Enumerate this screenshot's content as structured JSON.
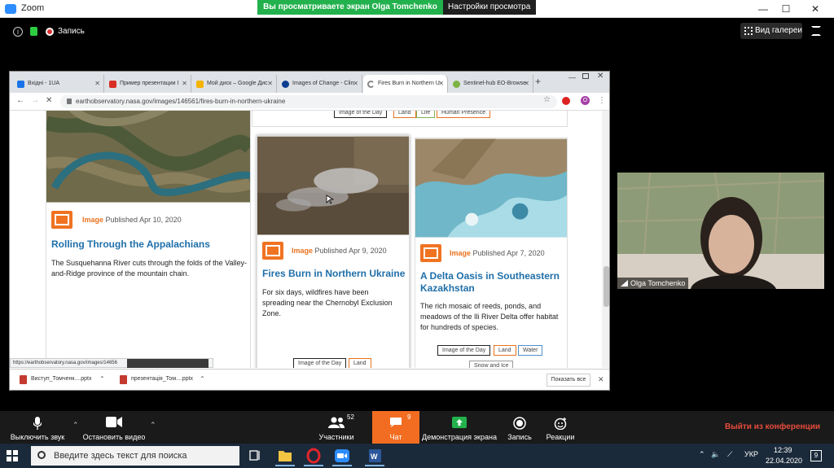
{
  "zoom": {
    "title": "Zoom",
    "share_banner": "Вы просматриваете экран Olga Tomchenko",
    "view_settings": "Настройки просмотра",
    "recording_label": "Запись",
    "gallery_label": "Вид галереи",
    "participant_name": "Olga Tomchenko"
  },
  "browser": {
    "tabs": [
      {
        "label": "Вхідні - 1UA",
        "color": "#1a73e8"
      },
      {
        "label": "Пример презентации І",
        "color": "#d93025"
      },
      {
        "label": "Мой диск – Google Дис",
        "color": "#f4b400"
      },
      {
        "label": "Images of Change - Clin",
        "color": "#0b3d91"
      },
      {
        "label": "Fires Burn in Northern U",
        "color": "#888888"
      },
      {
        "label": "Sentinel-hub EO-Browse",
        "color": "#7cb342"
      }
    ],
    "url": "earthobservatory.nasa.gov/images/146561/fires-burn-in-northern-ukraine",
    "profile_letter": "O",
    "status_url": "https://earthobservatory.nasa.gov/images/14656",
    "downloads": [
      {
        "name": "Виступ_Томченк....pptx"
      },
      {
        "name": "презентація_Том....pptx"
      }
    ],
    "show_all": "Показать все"
  },
  "page": {
    "top_tags": [
      "Image of the Day",
      "Land",
      "Life",
      "Human Presence"
    ],
    "cards": [
      {
        "type": "Image",
        "published": "Published Apr 10, 2020",
        "title": "Rolling Through the Appalachians",
        "desc": "The Susquehanna River cuts through the folds of the Valley-and-Ridge province of the mountain chain."
      },
      {
        "type": "Image",
        "published": "Published Apr 9, 2020",
        "title": "Fires Burn in Northern Ukraine",
        "desc": "For six days, wildfires have been spreading near the Chernobyl Exclusion Zone.",
        "tags": [
          "Image of the Day",
          "Land"
        ]
      },
      {
        "type": "Image",
        "published": "Published Apr 7, 2020",
        "title": "A Delta Oasis in Southeastern Kazakhstan",
        "desc": "The rich mosaic of reeds, ponds, and meadows of the Ili River Delta offer habitat for hundreds of species.",
        "tags": [
          "Image of the Day",
          "Land",
          "Water",
          "Snow and Ice"
        ]
      }
    ]
  },
  "toolbar": {
    "mute": "Выключить звук",
    "video": "Остановить видео",
    "participants": "Участники",
    "participants_count": "52",
    "chat": "Чат",
    "chat_count": "9",
    "share": "Демонстрация экрана",
    "record": "Запись",
    "reactions": "Реакции",
    "end": "Выйти из конференции"
  },
  "taskbar": {
    "search_placeholder": "Введите здесь текст для поиска",
    "lang": "УКР",
    "time": "12:39",
    "date": "22.04.2020",
    "notifications": "9"
  }
}
